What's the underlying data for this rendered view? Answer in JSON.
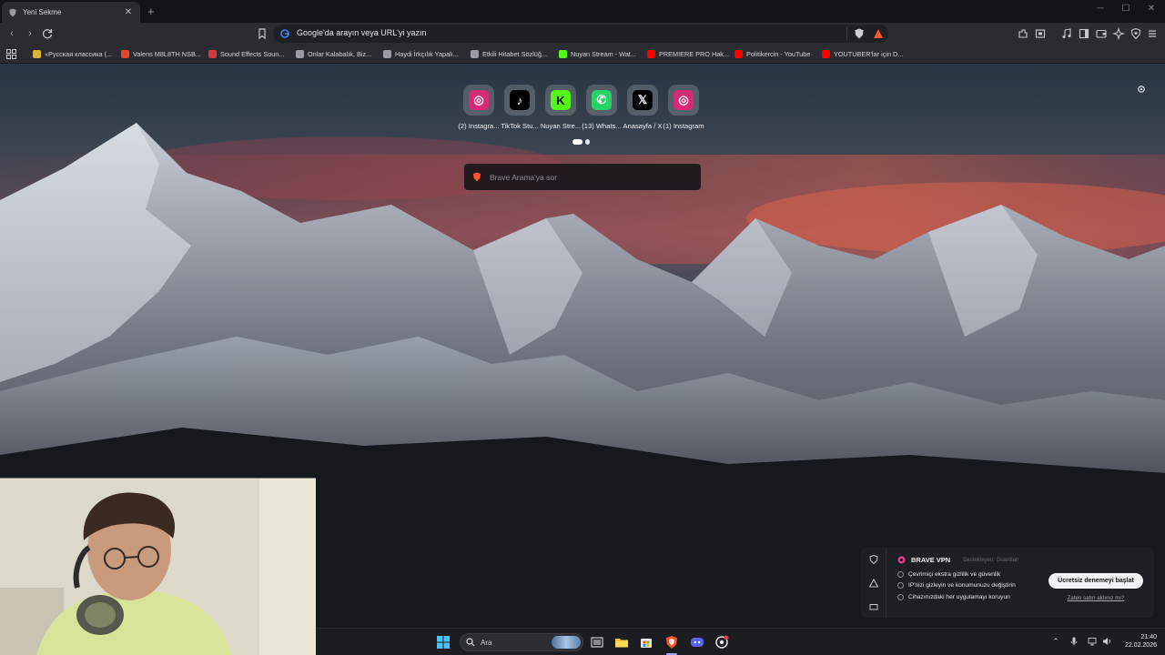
{
  "browser": {
    "tab": {
      "title": "Yeni Sekme",
      "close_glyph": "✕"
    },
    "new_tab_glyph": "+",
    "window_controls": {
      "minimize": "─",
      "maximize": "☐",
      "close": "✕"
    },
    "omnibox": {
      "placeholder": "Google'da arayın veya URL'yi yazın"
    },
    "bookmarks": [
      {
        "label": "«Русская классика (...",
        "icon": "star-icon",
        "color": "#d6b23a"
      },
      {
        "label": "Valens M8L8TH NSB...",
        "icon": "record-icon",
        "color": "#e2462b"
      },
      {
        "label": "Sound Effects Soun...",
        "icon": "sound-icon",
        "color": "#d23b3b"
      },
      {
        "label": "Onlar Kalabalık, Biz...",
        "icon": "globe-icon",
        "color": "#9a9aa2"
      },
      {
        "label": "Haydi İrkçılık Yapalı...",
        "icon": "globe-icon",
        "color": "#9a9aa2"
      },
      {
        "label": "Etkili Hitabet Sözlüğ...",
        "icon": "globe-icon",
        "color": "#9a9aa2"
      },
      {
        "label": "Nuyan Stream - Wat...",
        "icon": "kick-icon",
        "color": "#53fc18"
      },
      {
        "label": "PREMIERE PRO Hak...",
        "icon": "youtube-icon",
        "color": "#ff0000"
      },
      {
        "label": "Politikercin - YouTube",
        "icon": "youtube-icon",
        "color": "#ff0000"
      },
      {
        "label": "YOUTUBER'lar için D...",
        "icon": "youtube-icon",
        "color": "#ff0000"
      }
    ]
  },
  "ntp": {
    "top_sites": [
      {
        "label": "(2) Instagra...",
        "icon": "instagram-icon",
        "color": "#d62976"
      },
      {
        "label": "TikTok Stu...",
        "icon": "tiktok-icon",
        "color": "#000000"
      },
      {
        "label": "Nuyan Stre...",
        "icon": "kick-icon",
        "color": "#53fc18"
      },
      {
        "label": "(13) Whats...",
        "icon": "whatsapp-icon",
        "color": "#25d366"
      },
      {
        "label": "Anasayfa / X",
        "icon": "x-icon",
        "color": "#000000"
      },
      {
        "label": "(1) Instagram",
        "icon": "instagram-icon",
        "color": "#d62976"
      }
    ],
    "search_placeholder": "Brave Arama'ya sor"
  },
  "vpn_card": {
    "title": "BRAVE VPN",
    "powered_by": "Destekleyen:  Guardian",
    "features": [
      "Çevrimiçi ekstra gizlilik ve güvenlik",
      "IP'nizi gizleyin ve konumunuzu değiştirin",
      "Cihazınızdaki her uygulamayı koruyun"
    ],
    "cta": "Ücretsiz denemeyi başlat",
    "already_purchased": "Zaten satın aldınız mı?"
  },
  "taskbar": {
    "search_placeholder": "Ara",
    "time": "21:40",
    "date": "22.02.2026"
  },
  "colors": {
    "brave_orange": "#fb542b",
    "accent_purple": "#a0a5eb"
  }
}
